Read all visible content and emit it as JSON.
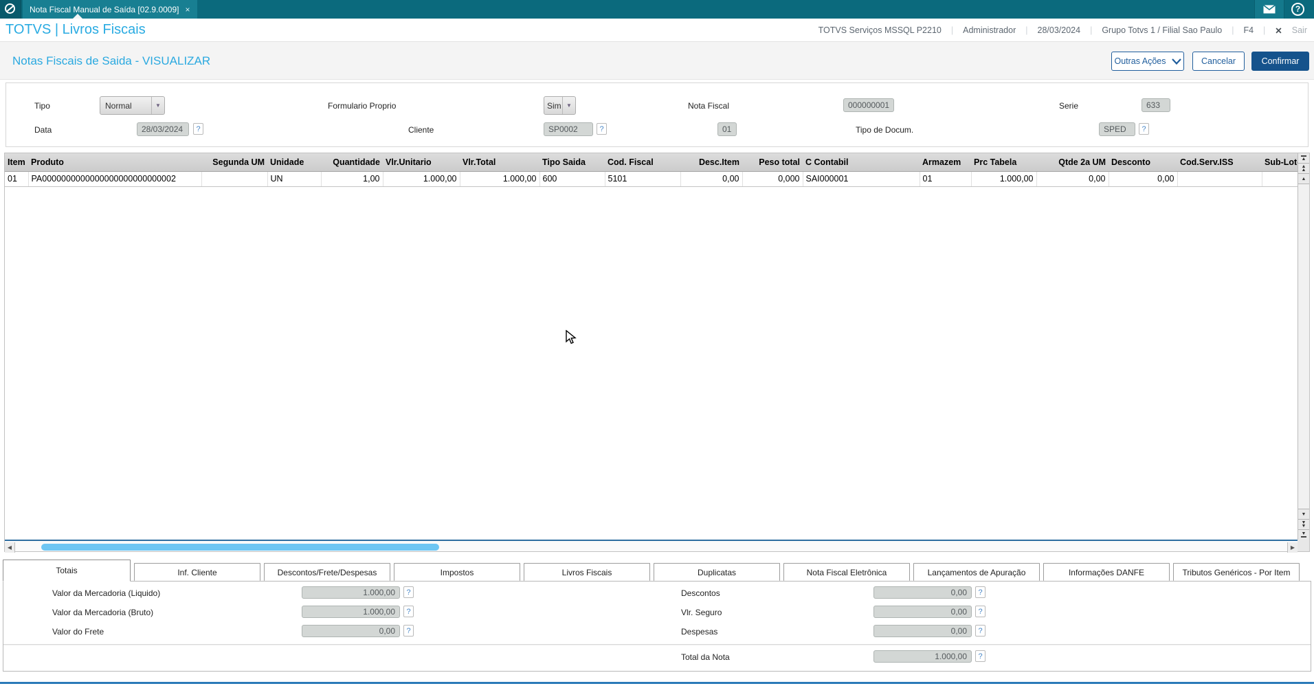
{
  "window": {
    "tab_title": "Nota Fiscal Manual de Saída [02.9.0009]",
    "tab_close": "×"
  },
  "header": {
    "brand": "TOTVS | Livros Fiscais",
    "environment": "TOTVS Serviços MSSQL P2210",
    "user": "Administrador",
    "date": "28/03/2024",
    "company": "Grupo Totvs 1 / Filial Sao Paulo",
    "f4": "F4",
    "logout": "Sair",
    "sep": "|",
    "close_x": "✕",
    "help": "?"
  },
  "titlebar": {
    "title": "Notas Fiscais de Saida - VISUALIZAR",
    "buttons": {
      "other_actions": "Outras Ações",
      "cancel": "Cancelar",
      "confirm": "Confirmar"
    }
  },
  "form": {
    "tipo": {
      "label": "Tipo",
      "value": "Normal"
    },
    "formulario_proprio": {
      "label": "Formulario Proprio",
      "value": "Sim"
    },
    "nota_fiscal": {
      "label": "Nota Fiscal",
      "value": "000000001"
    },
    "serie": {
      "label": "Serie",
      "value": "633"
    },
    "data": {
      "label": "Data",
      "value": "28/03/2024",
      "help": "?"
    },
    "cliente": {
      "label": "Cliente",
      "value": "SP0002",
      "help": "?"
    },
    "loja": {
      "value": "01"
    },
    "tipo_docum": {
      "label": "Tipo de Docum.",
      "value": "SPED",
      "help": "?"
    }
  },
  "grid": {
    "columns": [
      {
        "label": "Item"
      },
      {
        "label": "Produto"
      },
      {
        "label": "Segunda UM"
      },
      {
        "label": "Unidade"
      },
      {
        "label": "Quantidade"
      },
      {
        "label": "Vlr.Unitario"
      },
      {
        "label": "Vlr.Total"
      },
      {
        "label": "Tipo Saida"
      },
      {
        "label": "Cod. Fiscal"
      },
      {
        "label": "Desc.Item"
      },
      {
        "label": "Peso total"
      },
      {
        "label": "C Contabil"
      },
      {
        "label": "Armazem"
      },
      {
        "label": "Prc Tabela"
      },
      {
        "label": "Qtde 2a UM"
      },
      {
        "label": "Desconto"
      },
      {
        "label": "Cod.Serv.ISS"
      },
      {
        "label": "Sub-Lote"
      }
    ],
    "rows": [
      {
        "cells": [
          "01",
          "PA0000000000000000000000000002",
          "",
          "UN",
          "1,00",
          "1.000,00",
          "1.000,00",
          "600",
          "5101",
          "0,00",
          "0,000",
          "SAI000001",
          "01",
          "1.000,00",
          "0,00",
          "0,00",
          "",
          ""
        ]
      }
    ]
  },
  "tabs": [
    {
      "label": "Totais",
      "active": true
    },
    {
      "label": "Inf. Cliente"
    },
    {
      "label": "Descontos/Frete/Despesas"
    },
    {
      "label": "Impostos"
    },
    {
      "label": "Livros Fiscais"
    },
    {
      "label": "Duplicatas"
    },
    {
      "label": "Nota Fiscal Eletrônica"
    },
    {
      "label": "Lançamentos de Apuração"
    },
    {
      "label": "Informações DANFE"
    },
    {
      "label": "Tributos Genéricos - Por Item"
    }
  ],
  "totals": {
    "left": [
      {
        "label": "Valor da Mercadoria (Liquido)",
        "value": "1.000,00",
        "help": "?"
      },
      {
        "label": "Valor da Mercadoria (Bruto)",
        "value": "1.000,00",
        "help": "?"
      },
      {
        "label": "Valor do Frete",
        "value": "0,00",
        "help": "?"
      }
    ],
    "right": [
      {
        "label": "Descontos",
        "value": "0,00",
        "help": "?"
      },
      {
        "label": "Vlr. Seguro",
        "value": "0,00",
        "help": "?"
      },
      {
        "label": "Despesas",
        "value": "0,00",
        "help": "?"
      }
    ],
    "total": {
      "label": "Total da Nota",
      "value": "1.000,00",
      "help": "?"
    }
  },
  "colors": {
    "topbar": "#0b6a7d",
    "active_window_tab": "#187f92",
    "brand_accent": "#29abe2",
    "button_primary": "#15538c",
    "scroll_thumb": "#6ec6f3",
    "footer_line": "#2a7ab8",
    "disabled_field": "#d3d7d5"
  }
}
